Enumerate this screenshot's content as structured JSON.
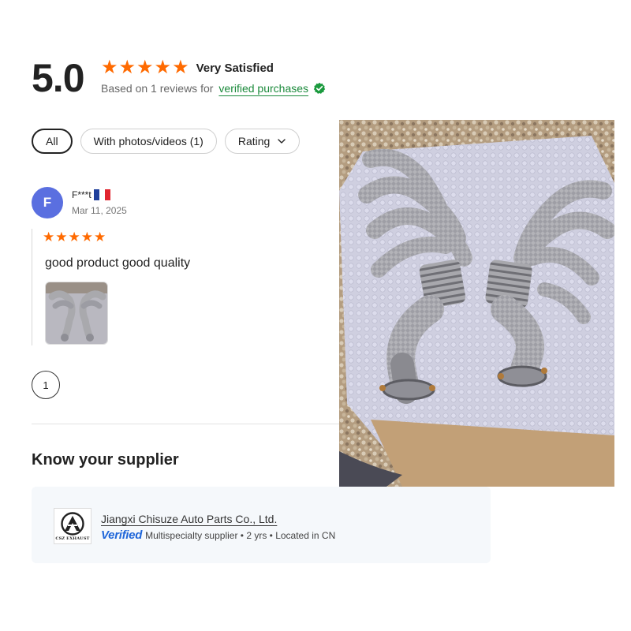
{
  "rating": {
    "score": "5.0",
    "stars": 5,
    "label": "Very Satisfied",
    "based_on_text": "Based on 1 reviews for",
    "verified_link": "verified purchases",
    "star_color": "#ff6a00",
    "verified_color": "#1b8a3b"
  },
  "filters": [
    {
      "label": "All",
      "active": true
    },
    {
      "label": "With photos/videos (1)",
      "active": false
    },
    {
      "label": "Rating",
      "active": false,
      "icon": "chevron-down-icon"
    }
  ],
  "review": {
    "avatar_letter": "F",
    "avatar_color": "#5a6fe0",
    "reviewer": "F***t",
    "country_flag": "france-flag-icon",
    "date": "Mar 11, 2025",
    "stars": 5,
    "text": "good product good quality",
    "photo": "exhaust-manifold-photo"
  },
  "pagination": {
    "current_page": "1"
  },
  "supplier": {
    "heading": "Know your supplier",
    "name": "Jiangxi Chisuze Auto Parts Co., Ltd.",
    "logo_text": "CSZ EXHAUST",
    "verified_badge": "Verified",
    "meta": "Multispecialty supplier • 2 yrs • Located in CN",
    "verified_color": "#1f66d9"
  }
}
